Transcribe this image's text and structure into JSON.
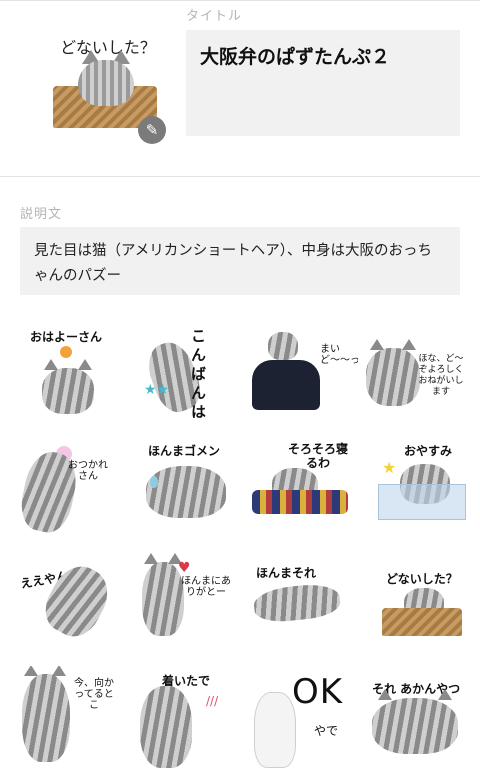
{
  "header": {
    "title_section_label": "タイトル",
    "description_section_label": "説明文"
  },
  "main_sticker": {
    "caption": "どないした？",
    "edit_icon": "pencil-icon"
  },
  "title_field": {
    "value": "大阪弁のぱずたんぷ２"
  },
  "description_field": {
    "value": "見た目は猫（アメリカンショートヘア）、中身は大阪のおっちゃんのパズー"
  },
  "stickers": [
    {
      "text": "おはよーさん"
    },
    {
      "text": "こんばんは"
    },
    {
      "text": "まいど〜〜っ"
    },
    {
      "text": "ほな、ど〜ぞよろしくおねがいします"
    },
    {
      "text": "おつかれさん"
    },
    {
      "text": "ほんまゴメン"
    },
    {
      "text": "そろそろ寝るわ"
    },
    {
      "text": "おやすみ"
    },
    {
      "text": "ええやん！"
    },
    {
      "text": "ほんまにありがとー"
    },
    {
      "text": "ほんまそれ"
    },
    {
      "text": "どないした？"
    },
    {
      "text": "今、向かってるとこ"
    },
    {
      "text": "着いたで"
    },
    {
      "text": "OK",
      "subtext": "やで"
    },
    {
      "text": "それ あかんやつ"
    }
  ],
  "colors": {
    "field_background": "#f1f1f1",
    "section_label": "#b4b4b4",
    "edit_button": "#7b7b7b"
  }
}
